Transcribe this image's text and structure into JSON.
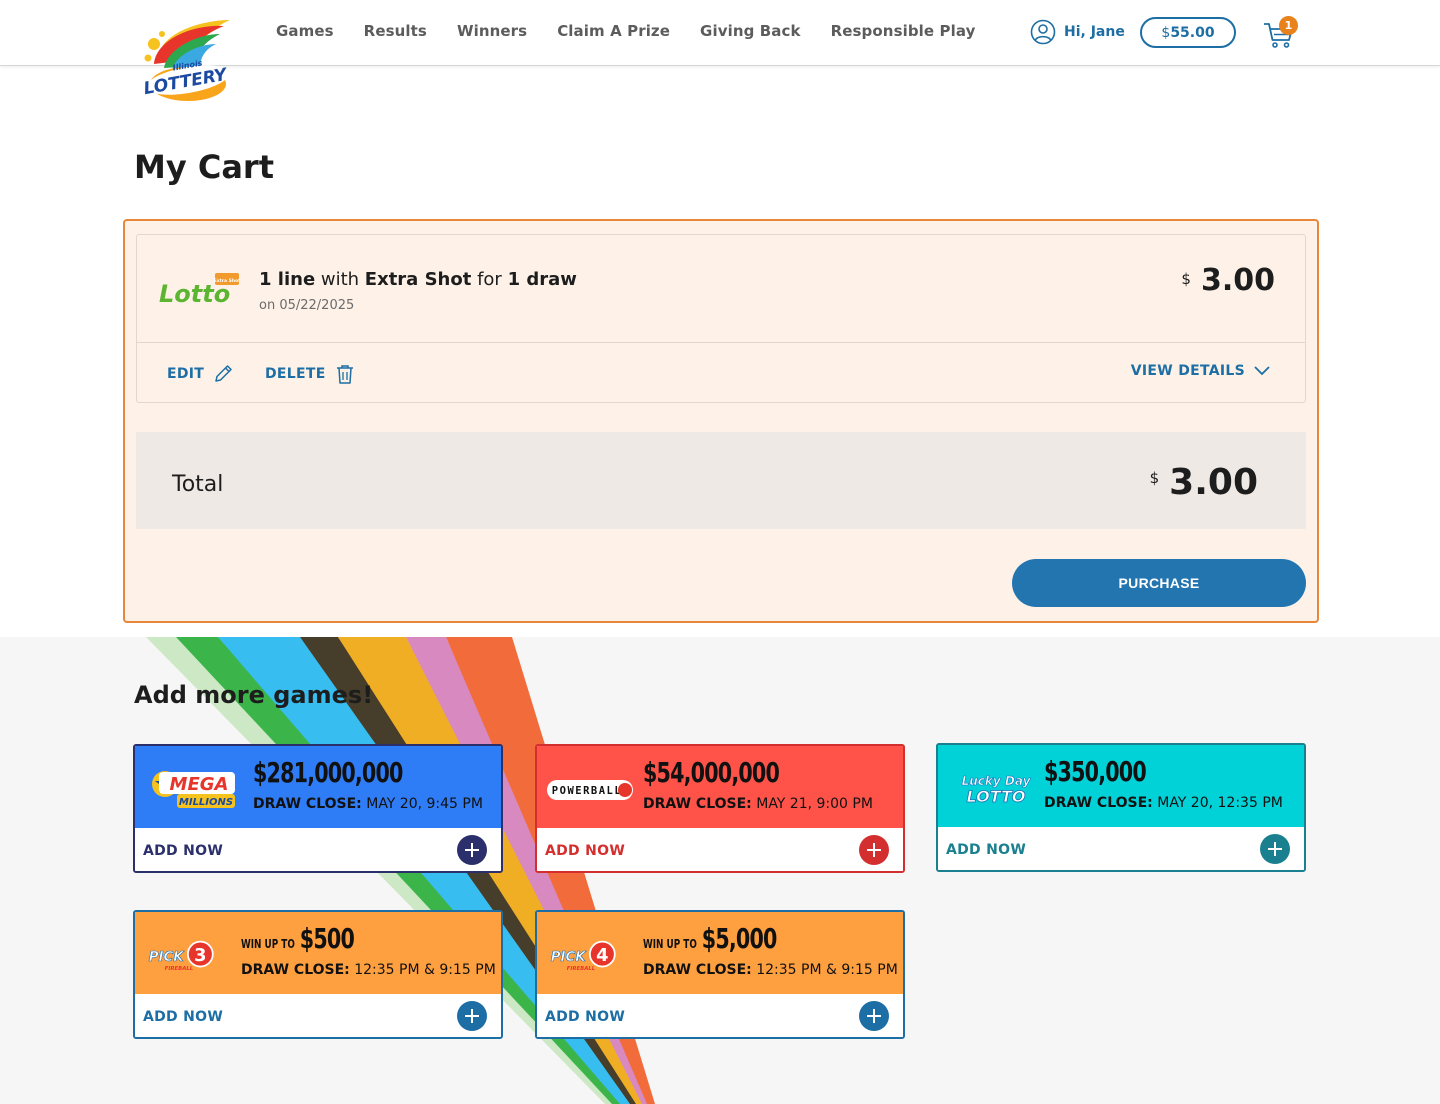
{
  "header": {
    "nav": [
      "Games",
      "Results",
      "Winners",
      "Claim A Prize",
      "Giving Back",
      "Responsible Play"
    ],
    "greeting": "Hi, Jane",
    "balance_currency": "$",
    "balance_amount": "55.00",
    "cart_count": "1",
    "logo_text_top": "Illinois",
    "logo_text_main": "LOTTERY"
  },
  "page": {
    "title": "My Cart"
  },
  "cart_item": {
    "logo_text": "Lotto",
    "logo_badge": "Extra Shot",
    "qty": "1 line",
    "w1": " with ",
    "addon": "Extra Shot",
    "w2": " for ",
    "draws": "1 draw",
    "date": "on 05/22/2025",
    "currency": "$",
    "price": "3.00",
    "edit_label": "EDIT",
    "delete_label": "DELETE",
    "details_label": "VIEW DETAILS"
  },
  "total": {
    "label": "Total",
    "currency": "$",
    "amount": "3.00"
  },
  "purchase_label": "PURCHASE",
  "more": {
    "title": "Add more games!",
    "add_label": "ADD NOW",
    "close_label": "DRAW CLOSE:",
    "games": [
      {
        "name": "Mega Millions",
        "jackpot": "$281,000,000",
        "close": "MAY 20, 9:45 PM",
        "bg": "#2e7cf6",
        "border": "#2b2f6b",
        "add_color": "#2b2f6b",
        "plus": "#2b2f6b"
      },
      {
        "name": "Powerball",
        "jackpot": "$54,000,000",
        "close": "MAY 21, 9:00 PM",
        "bg": "#ff5349",
        "border": "#d32f2f",
        "add_color": "#d32f2f",
        "plus": "#d32f2f"
      },
      {
        "name": "Lucky Day Lotto",
        "jackpot": "$350,000",
        "close": "MAY 20, 12:35 PM",
        "bg": "#00d2d8",
        "border": "#1a7f8e",
        "add_color": "#1a7f8e",
        "plus": "#1a7f8e"
      },
      {
        "name": "Pick 3",
        "winup": "WIN UP TO",
        "jackpot": "$500",
        "close": "12:35 PM & 9:15 PM",
        "bg": "#ffa040",
        "border": "#1c6ea4",
        "add_color": "#1c6ea4",
        "plus": "#1c6ea4"
      },
      {
        "name": "Pick 4",
        "winup": "WIN UP TO",
        "jackpot": "$5,000",
        "close": "12:35 PM & 9:15 PM",
        "bg": "#ffa040",
        "border": "#1c6ea4",
        "add_color": "#1c6ea4",
        "plus": "#1c6ea4"
      }
    ]
  },
  "logo_labels": {
    "mega": "MEGA",
    "millions": "MILLIONS",
    "powerball": "POWERBALL",
    "lucky": "Lucky Day",
    "lotto": "LOTTO",
    "pick": "PICK",
    "fireball": "FIREBALL",
    "three": "3",
    "four": "4"
  }
}
